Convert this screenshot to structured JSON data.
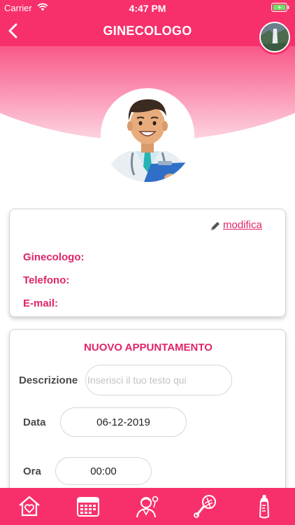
{
  "status_bar": {
    "carrier": "Carrier",
    "time": "4:47 PM"
  },
  "header": {
    "title": "GINECOLOGO"
  },
  "info_card": {
    "edit_label": "modifica",
    "fields": [
      {
        "label": "Ginecologo:"
      },
      {
        "label": "Telefono:"
      },
      {
        "label": "E-mail:"
      }
    ]
  },
  "appointment": {
    "title": "NUOVO APPUNTAMENTO",
    "description": {
      "label": "Descrizione",
      "placeholder": "Inserisci il tuo testo qui"
    },
    "date": {
      "label": "Data",
      "value": "06-12-2019"
    },
    "time": {
      "label": "Ora",
      "value": "00:00"
    }
  },
  "bottom_nav": {
    "items": [
      {
        "icon": "home-heart-icon"
      },
      {
        "icon": "calendar-icon"
      },
      {
        "icon": "doctor-icon"
      },
      {
        "icon": "baby-rattle-icon"
      },
      {
        "icon": "baby-bottle-icon"
      }
    ]
  },
  "colors": {
    "brand_pink": "#f7306c",
    "label_pink": "#e0246a"
  }
}
